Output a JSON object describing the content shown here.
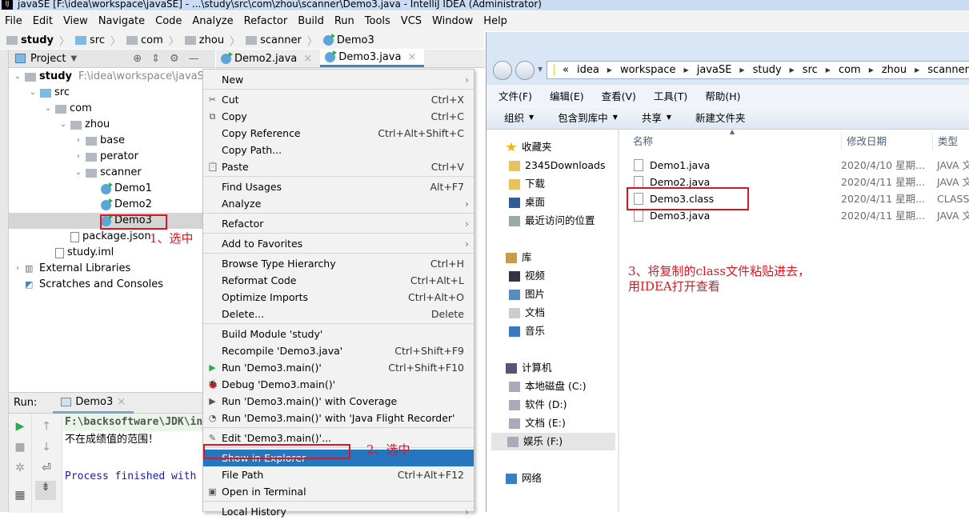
{
  "window": {
    "title": "javaSE [F:\\idea\\workspace\\javaSE] - ...\\study\\src\\com\\zhou\\scanner\\Demo3.java - IntelliJ IDEA (Administrator)",
    "logo": "IJ"
  },
  "menubar": [
    "File",
    "Edit",
    "View",
    "Navigate",
    "Code",
    "Analyze",
    "Refactor",
    "Build",
    "Run",
    "Tools",
    "VCS",
    "Window",
    "Help"
  ],
  "breadcrumb": [
    "study",
    "src",
    "com",
    "zhou",
    "scanner",
    "Demo3"
  ],
  "project_panel": {
    "title": "Project",
    "icons": [
      "locate-icon",
      "collapse-icon",
      "gear-icon",
      "minimize-icon"
    ]
  },
  "editor_tabs": [
    {
      "label": "Demo2.java",
      "active": false
    },
    {
      "label": "Demo3.java",
      "active": true
    }
  ],
  "tree": [
    {
      "label": "study",
      "extra": "F:\\idea\\workspace\\javaSE\\st",
      "depth": 0,
      "arrow": "v",
      "icon": "module",
      "bold": true
    },
    {
      "label": "src",
      "depth": 1,
      "arrow": "v",
      "icon": "folder-blue"
    },
    {
      "label": "com",
      "depth": 2,
      "arrow": "v",
      "icon": "folder"
    },
    {
      "label": "zhou",
      "depth": 3,
      "arrow": "v",
      "icon": "folder"
    },
    {
      "label": "base",
      "depth": 4,
      "arrow": ">",
      "icon": "folder"
    },
    {
      "label": "perator",
      "depth": 4,
      "arrow": ">",
      "icon": "folder"
    },
    {
      "label": "scanner",
      "depth": 4,
      "arrow": "v",
      "icon": "folder"
    },
    {
      "label": "Demo1",
      "depth": 5,
      "arrow": "",
      "icon": "class"
    },
    {
      "label": "Demo2",
      "depth": 5,
      "arrow": "",
      "icon": "class"
    },
    {
      "label": "Demo3",
      "depth": 5,
      "arrow": "",
      "icon": "class",
      "selected": true
    },
    {
      "label": "package.json",
      "depth": 3,
      "arrow": "",
      "icon": "file"
    },
    {
      "label": "study.iml",
      "depth": 2,
      "arrow": "",
      "icon": "file"
    },
    {
      "label": "External Libraries",
      "depth": 0,
      "arrow": ">",
      "icon": "library"
    },
    {
      "label": "Scratches and Consoles",
      "depth": 0,
      "arrow": "",
      "icon": "scratch"
    }
  ],
  "run": {
    "label": "Run:",
    "tab": "Demo3",
    "lines": [
      "F:\\backsoftware\\JDK\\in",
      "不在成绩值的范围！",
      "",
      "Process finished with"
    ]
  },
  "context_menu": [
    {
      "label": "New",
      "sub": true
    },
    "-",
    {
      "label": "Cut",
      "shortcut": "Ctrl+X",
      "icon": "✂"
    },
    {
      "label": "Copy",
      "shortcut": "Ctrl+C",
      "icon": "⧉"
    },
    {
      "label": "Copy Reference",
      "shortcut": "Ctrl+Alt+Shift+C"
    },
    {
      "label": "Copy Path...",
      "shortcut": ""
    },
    {
      "label": "Paste",
      "shortcut": "Ctrl+V",
      "icon": "📋"
    },
    "-",
    {
      "label": "Find Usages",
      "shortcut": "Alt+F7"
    },
    {
      "label": "Analyze",
      "sub": true
    },
    "-",
    {
      "label": "Refactor",
      "sub": true
    },
    "-",
    {
      "label": "Add to Favorites",
      "sub": true
    },
    "-",
    {
      "label": "Browse Type Hierarchy",
      "shortcut": "Ctrl+H"
    },
    {
      "label": "Reformat Code",
      "shortcut": "Ctrl+Alt+L"
    },
    {
      "label": "Optimize Imports",
      "shortcut": "Ctrl+Alt+O"
    },
    {
      "label": "Delete...",
      "shortcut": "Delete"
    },
    "-",
    {
      "label": "Build Module 'study'",
      "shortcut": ""
    },
    {
      "label": "Recompile 'Demo3.java'",
      "shortcut": "Ctrl+Shift+F9"
    },
    {
      "label": "Run 'Demo3.main()'",
      "shortcut": "Ctrl+Shift+F10",
      "icon": "▶",
      "iconColor": "#2fa84f"
    },
    {
      "label": "Debug 'Demo3.main()'",
      "shortcut": "",
      "icon": "🐞"
    },
    {
      "label": "Run 'Demo3.main()' with Coverage",
      "shortcut": "",
      "icon": "▶"
    },
    {
      "label": "Run 'Demo3.main()' with 'Java Flight Recorder'",
      "shortcut": "",
      "icon": "◔"
    },
    "-",
    {
      "label": "Edit 'Demo3.main()'...",
      "shortcut": "",
      "icon": "✎"
    },
    "-",
    {
      "label": "Show in Explorer",
      "shortcut": "",
      "highlight": true
    },
    {
      "label": "File Path",
      "shortcut": "Ctrl+Alt+F12"
    },
    {
      "label": "Open in Terminal",
      "shortcut": "",
      "icon": "▣"
    },
    "-",
    {
      "label": "Local History",
      "sub": true
    }
  ],
  "explorer": {
    "address": [
      "«",
      "idea",
      "workspace",
      "javaSE",
      "study",
      "src",
      "com",
      "zhou",
      "scanner"
    ],
    "menu": [
      "文件(F)",
      "编辑(E)",
      "查看(V)",
      "工具(T)",
      "帮助(H)"
    ],
    "toolbar": [
      {
        "label": "组织",
        "dropdown": true
      },
      {
        "label": "包含到库中",
        "dropdown": true
      },
      {
        "label": "共享",
        "dropdown": true
      },
      {
        "label": "新建文件夹",
        "dropdown": false
      }
    ],
    "nav": [
      {
        "label": "收藏夹",
        "icon": "star",
        "top": 0
      },
      {
        "label": "2345Downloads",
        "icon": "folder",
        "indent": true
      },
      {
        "label": "下载",
        "icon": "download-folder",
        "indent": true
      },
      {
        "label": "桌面",
        "icon": "desktop",
        "indent": true
      },
      {
        "label": "最近访问的位置",
        "icon": "recent",
        "indent": true
      },
      {
        "label": "库",
        "icon": "library",
        "gap": true
      },
      {
        "label": "视频",
        "icon": "video",
        "indent": true
      },
      {
        "label": "图片",
        "icon": "pictures",
        "indent": true
      },
      {
        "label": "文档",
        "icon": "documents",
        "indent": true
      },
      {
        "label": "音乐",
        "icon": "music",
        "indent": true
      },
      {
        "label": "计算机",
        "icon": "computer",
        "gap": true
      },
      {
        "label": "本地磁盘 (C:)",
        "icon": "drive",
        "indent": true
      },
      {
        "label": "软件 (D:)",
        "icon": "drive",
        "indent": true
      },
      {
        "label": "文档 (E:)",
        "icon": "drive",
        "indent": true
      },
      {
        "label": "娱乐 (F:)",
        "icon": "drive",
        "indent": true,
        "selected": true
      },
      {
        "label": "网络",
        "icon": "network",
        "gap": true
      }
    ],
    "columns": [
      "名称",
      "修改日期",
      "类型"
    ],
    "files": [
      {
        "name": "Demo1.java",
        "date": "2020/4/10 星期...",
        "type": "JAVA 文"
      },
      {
        "name": "Demo2.java",
        "date": "2020/4/11 星期...",
        "type": "JAVA 文"
      },
      {
        "name": "Demo3.class",
        "date": "2020/4/11 星期...",
        "type": "CLASS"
      },
      {
        "name": "Demo3.java",
        "date": "2020/4/11 星期...",
        "type": "JAVA 文"
      }
    ]
  },
  "annotations": {
    "step1": "1、选中",
    "step2": "2、选中",
    "step3_line1": "3、将复制的class文件粘贴进去，",
    "step3_line2": "用IDEA打开查看",
    "color": "#e0141e"
  }
}
